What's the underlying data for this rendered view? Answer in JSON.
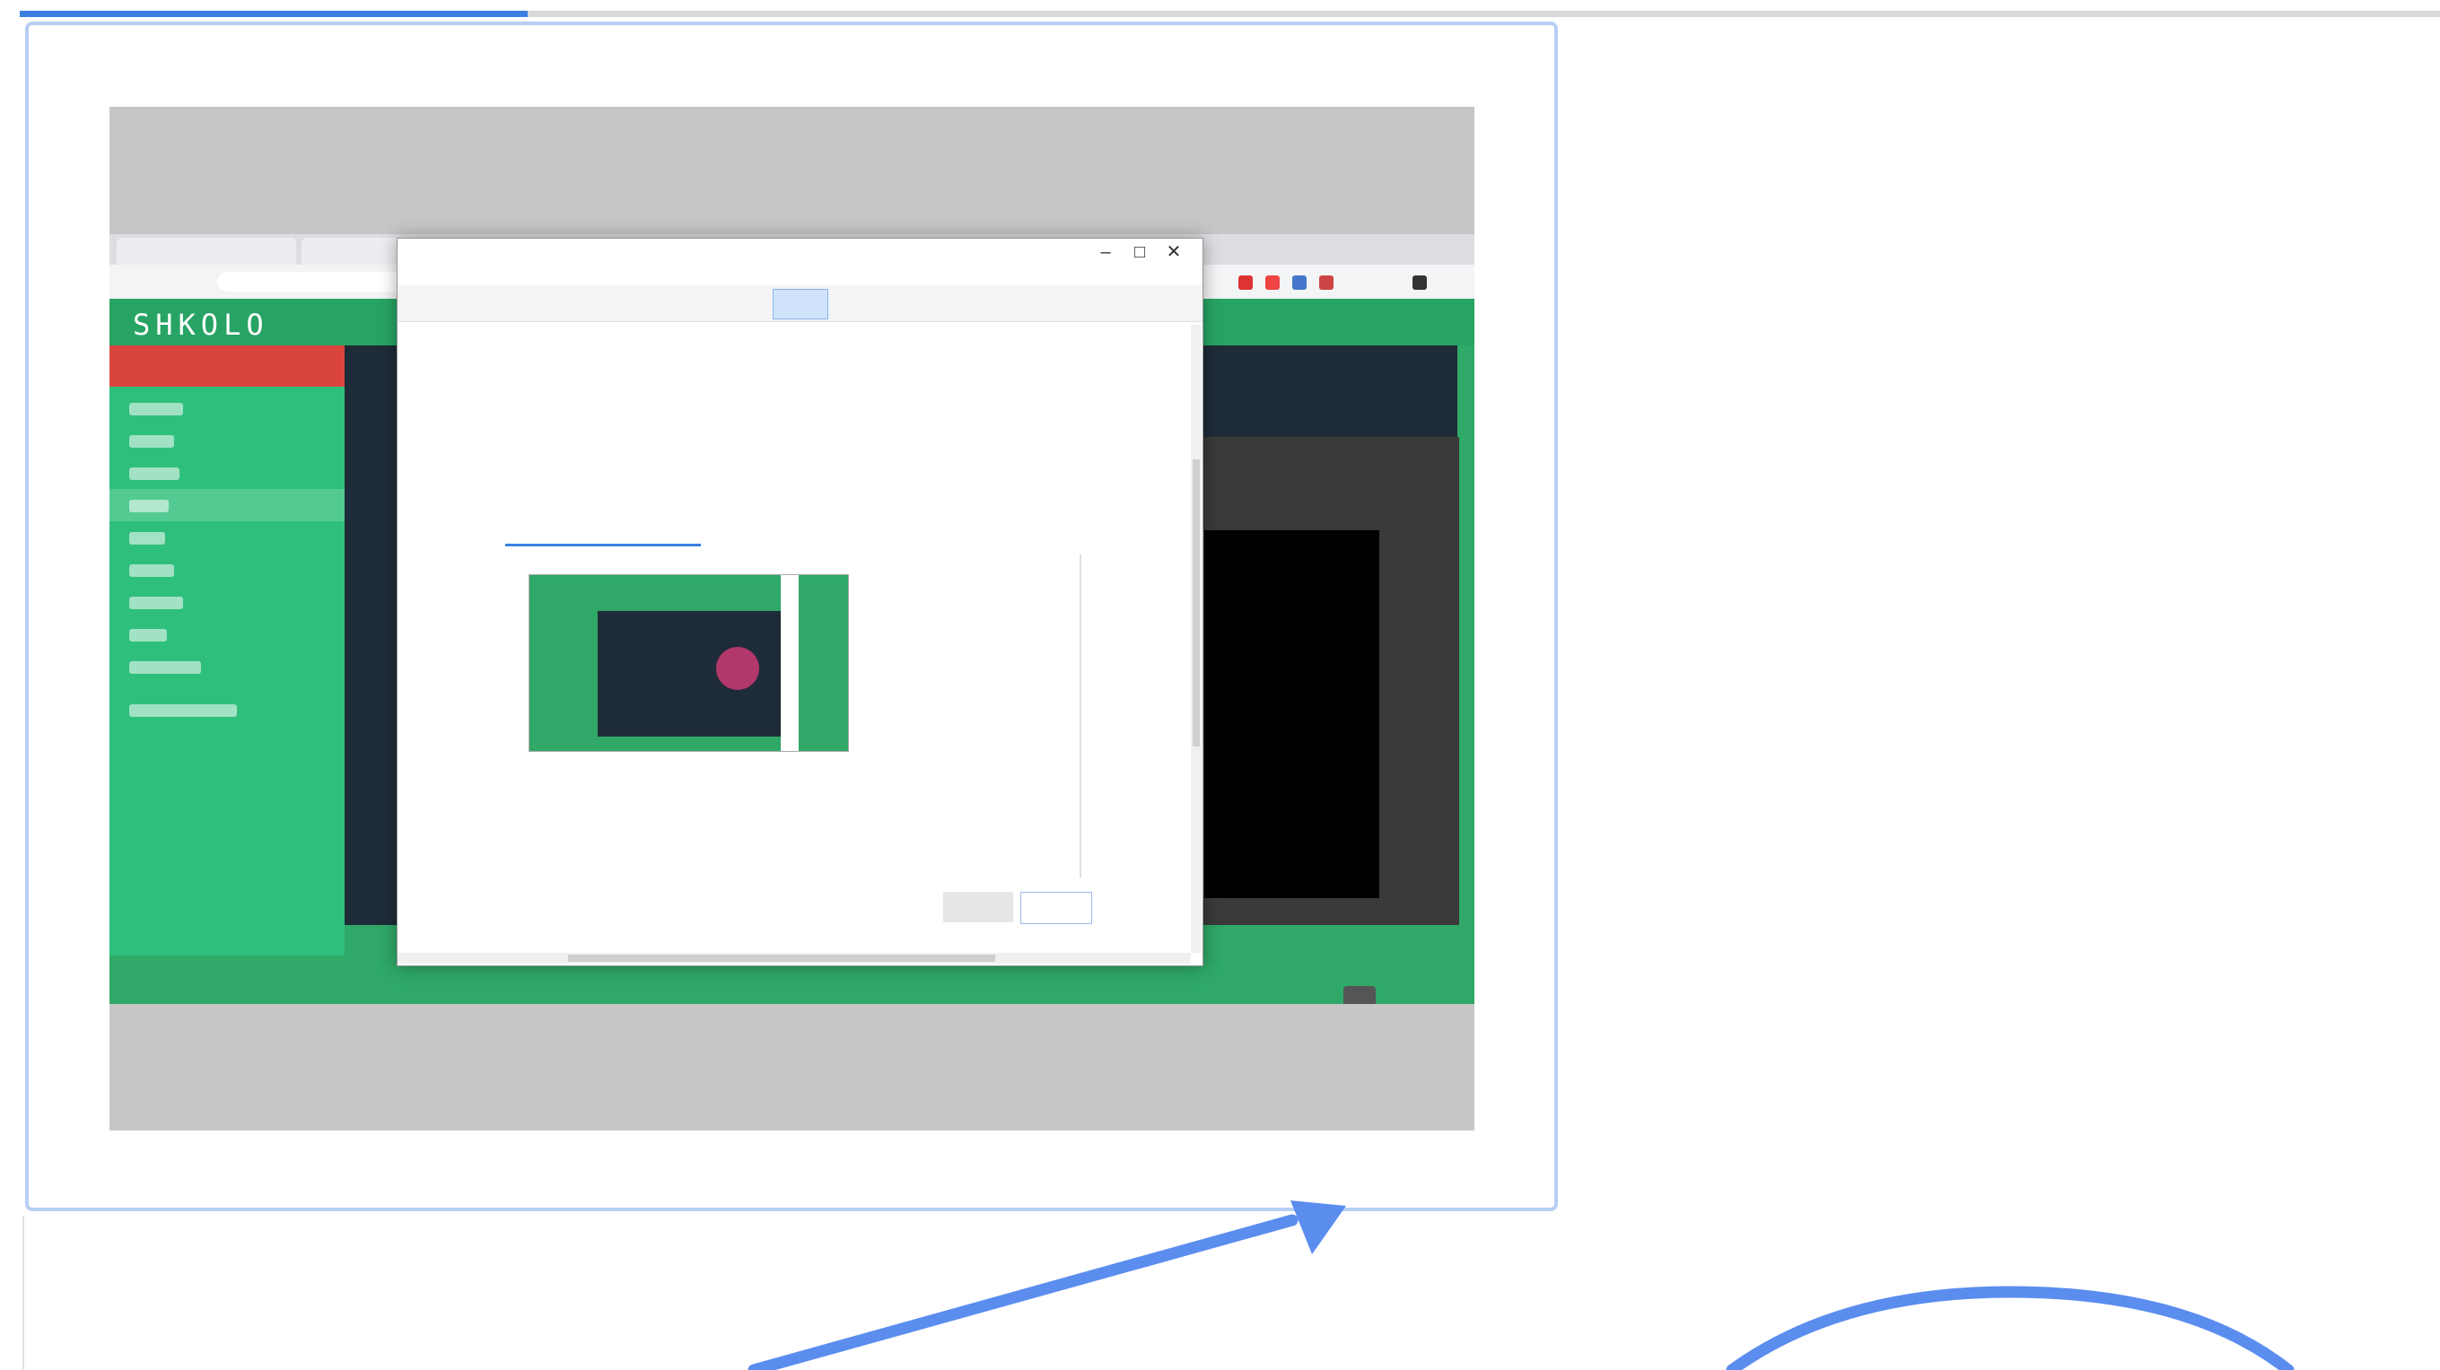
{
  "colors": {
    "accent": "#3b7fe0",
    "annotation": "#5b8def",
    "frame": "#b7cff5",
    "app_green": "#2fbf7c",
    "alert_red": "#d9453c"
  },
  "progress": {
    "fraction": 0.21
  },
  "captured_screenshot": {
    "app_logo": "SHKOLO",
    "dialog": {
      "window_buttons": [
        "–",
        "□",
        "✕"
      ]
    }
  },
  "annotations": {
    "arrow": "arrow-annotation",
    "circle": "circle-annotation"
  }
}
